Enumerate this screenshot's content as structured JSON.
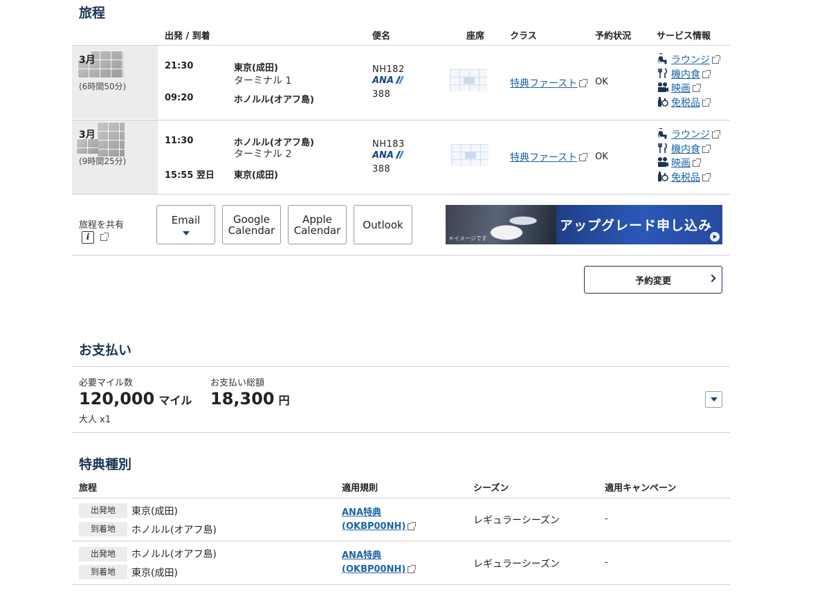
{
  "itinerary": {
    "title": "旅程",
    "headers": {
      "depart_arrive": "出発 / 到着",
      "flight": "便名",
      "seat": "座席",
      "class": "クラス",
      "status": "予約状況",
      "service": "サービス情報"
    },
    "flights": [
      {
        "month": "3月",
        "duration": "(6時間50分)",
        "dep_time": "21:30",
        "dep_airport": "東京(成田)",
        "dep_terminal": "ターミナル 1",
        "arr_time": "09:20",
        "arr_airport": "ホノルル(オアフ島)",
        "flight_no": "NH182",
        "airline": "ANA",
        "aircraft": "388",
        "class": "特典ファースト",
        "status": "OK",
        "services": [
          "ラウンジ",
          "機内食",
          "映画",
          "免税品"
        ]
      },
      {
        "month": "3月",
        "duration": "(9時間25分)",
        "dep_time": "11:30",
        "dep_airport": "ホノルル(オアフ島)",
        "dep_terminal": "ターミナル 2",
        "arr_time": "15:55 翌日",
        "arr_airport": "東京(成田)",
        "flight_no": "NH183",
        "airline": "ANA",
        "aircraft": "388",
        "class": "特典ファースト",
        "status": "OK",
        "services": [
          "ラウンジ",
          "機内食",
          "映画",
          "免税品"
        ]
      }
    ],
    "share_label": "旅程を共有",
    "share_buttons": {
      "email": "Email",
      "google_1": "Google",
      "google_2": "Calendar",
      "apple_1": "Apple",
      "apple_2": "Calendar",
      "outlook": "Outlook"
    },
    "banner_text": "アップグレード申し込み",
    "banner_note": "＊イメージです",
    "change_button": "予約変更"
  },
  "payment": {
    "title": "お支払い",
    "miles_label": "必要マイル数",
    "miles_value": "120,000",
    "miles_unit": "マイル",
    "passengers": "大人 x1",
    "total_label": "お支払い総額",
    "total_value": "18,300",
    "total_unit": "円"
  },
  "award": {
    "title": "特典種別",
    "headers": {
      "itinerary": "旅程",
      "rule": "適用規則",
      "season": "シーズン",
      "campaign": "適用キャンペーン"
    },
    "origin_label": "出発地",
    "dest_label": "到着地",
    "rows": [
      {
        "origin": "東京(成田)",
        "dest": "ホノルル(オアフ島)",
        "rule_1": "ANA特典",
        "rule_2": "(OKBP00NH)",
        "season": "レギュラーシーズン",
        "campaign": "-"
      },
      {
        "origin": "ホノルル(オアフ島)",
        "dest": "東京(成田)",
        "rule_1": "ANA特典",
        "rule_2": "(OKBP00NH)",
        "season": "レギュラーシーズン",
        "campaign": "-"
      }
    ]
  },
  "colors": {
    "heading": "#1a3356",
    "link": "#1b64a8",
    "date_bg": "#ececec"
  }
}
